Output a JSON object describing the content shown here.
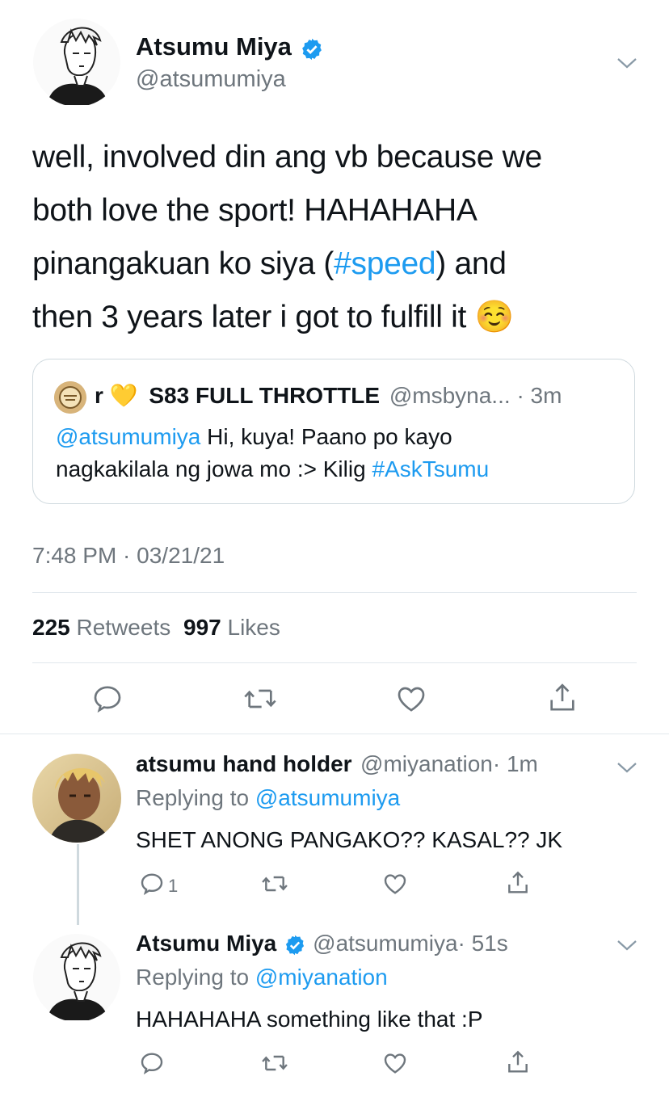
{
  "main_tweet": {
    "author_name": "Atsumu Miya",
    "author_handle": "@atsumumiya",
    "text_lines": [
      "well, involved din ang vb because we",
      "both love the sport! HAHAHAHA",
      "pinangakuan ko siya (",
      "#speed",
      ") and",
      "then 3 years later i got to fulfill it",
      "☺️"
    ],
    "quoted": {
      "name_prefix": "r",
      "heart_emoji": "💛",
      "name_suffix": "S83 FULL THROTTLE",
      "handle": "@msbyna...",
      "time": "· 3m",
      "mention": "@atsumumiya",
      "text_part1": " Hi, kuya! Paano po kayo",
      "text_part2": "nagkakilala ng jowa mo :> Kilig ",
      "hashtag": "#AskTsumu"
    },
    "timestamp": "7:48 PM · 03/21/21",
    "retweets_count": "225",
    "retweets_label": "Retweets",
    "likes_count": "997",
    "likes_label": "Likes"
  },
  "replies": [
    {
      "name": "atsumu hand holder",
      "handle": "@miyanation",
      "time": "· 1m",
      "replying_label": "Replying to ",
      "replying_to": "@atsumumiya",
      "text": "SHET ANONG PANGAKO?? KASAL?? JK",
      "reply_count": "1"
    },
    {
      "name": "Atsumu Miya",
      "handle": "@atsumumiya",
      "time": "· 51s",
      "replying_label": "Replying to ",
      "replying_to": "@miyanation",
      "text": "HAHAHAHA something like that :P",
      "reply_count": ""
    }
  ],
  "colors": {
    "accent": "#1d9bf0",
    "muted": "#6e767d",
    "text": "#0f1419",
    "divider": "#e1e8ed"
  },
  "icons": [
    "reply-icon",
    "retweet-icon",
    "like-icon",
    "share-icon",
    "chevron-down-icon",
    "verified-badge-icon"
  ]
}
